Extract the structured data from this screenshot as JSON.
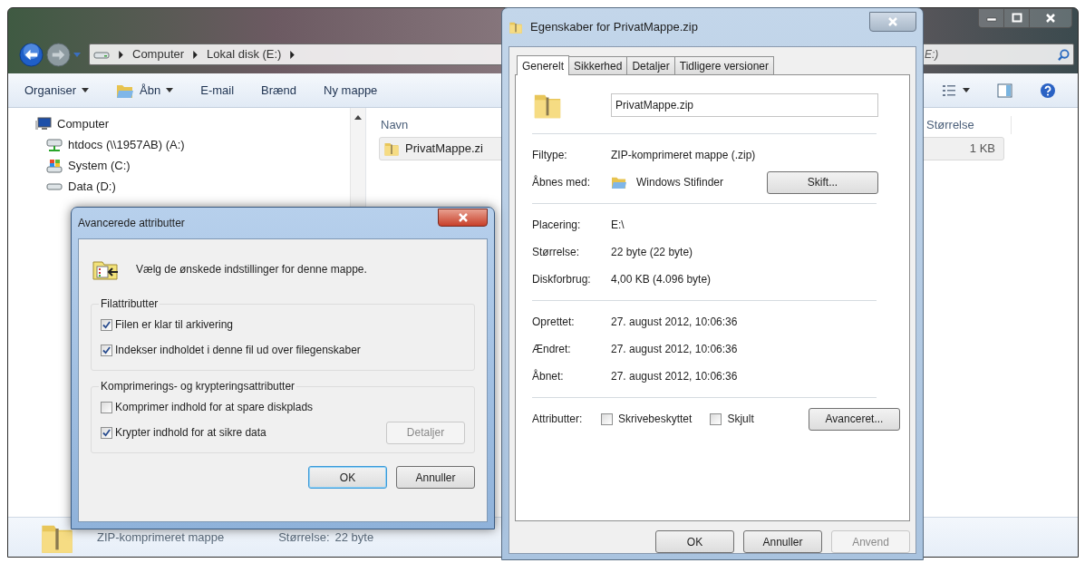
{
  "explorer": {
    "address": {
      "segments": [
        "Computer",
        "Lokal disk (E:)"
      ]
    },
    "search": {
      "placeholder": "E:)"
    },
    "toolbar": [
      {
        "label": "Organiser",
        "kind": "menu"
      },
      {
        "label": "Åbn",
        "kind": "open"
      },
      {
        "label": "E-mail",
        "kind": "plain"
      },
      {
        "label": "Brænd",
        "kind": "plain"
      },
      {
        "label": "Ny mappe",
        "kind": "plain"
      }
    ],
    "nav": [
      {
        "label": "Computer",
        "kind": "computer",
        "children": [
          {
            "label": "htdocs (\\\\1957AB) (A:)",
            "kind": "network"
          },
          {
            "label": "System (C:)",
            "kind": "system"
          },
          {
            "label": "Data (D:)",
            "kind": "drive"
          }
        ]
      }
    ],
    "columns": [
      "Navn",
      "Størrelse"
    ],
    "files": [
      {
        "name": "PrivatMappe.zi",
        "size": "1 KB",
        "selected": true
      }
    ],
    "details": {
      "type": "ZIP-komprimeret mappe",
      "size_label": "Størrelse:",
      "size": "22 byte"
    }
  },
  "properties": {
    "title": "Egenskaber for PrivatMappe.zip",
    "tabs": [
      {
        "label": "Generelt",
        "selected": true
      },
      {
        "label": "Sikkerhed",
        "selected": false
      },
      {
        "label": "Detaljer",
        "selected": false
      },
      {
        "label": "Tidligere versioner",
        "selected": false
      }
    ],
    "name": "PrivatMappe.zip",
    "sections": [
      [
        {
          "kind": "text",
          "label": "Filtype:",
          "value": "ZIP-komprimeret mappe (.zip)"
        },
        {
          "kind": "app",
          "label": "Åbnes med:",
          "value": "Windows Stifinder",
          "button": "Skift..."
        }
      ],
      [
        {
          "kind": "text",
          "label": "Placering:",
          "value": "E:\\"
        },
        {
          "kind": "text",
          "label": "Størrelse:",
          "value": "22 byte (22 byte)"
        },
        {
          "kind": "text",
          "label": "Diskforbrug:",
          "value": "4,00 KB (4.096 byte)"
        }
      ],
      [
        {
          "kind": "text",
          "label": "Oprettet:",
          "value": "27. august 2012, 10:06:36"
        },
        {
          "kind": "text",
          "label": "Ændret:",
          "value": "27. august 2012, 10:06:36"
        },
        {
          "kind": "text",
          "label": "Åbnet:",
          "value": "27. august 2012, 10:06:36"
        }
      ]
    ],
    "attributes": {
      "label": "Attributter:",
      "checkboxes": [
        {
          "label": "Skrivebeskyttet",
          "checked": false
        },
        {
          "label": "Skjult",
          "checked": false
        }
      ],
      "button": "Avanceret..."
    },
    "buttons": [
      {
        "label": "OK",
        "disabled": false
      },
      {
        "label": "Annuller",
        "disabled": false
      },
      {
        "label": "Anvend",
        "disabled": true
      }
    ]
  },
  "advanced": {
    "title": "Avancerede attributter",
    "intro": "Vælg de ønskede indstillinger for denne mappe.",
    "groups": [
      {
        "title": "Filattributter",
        "options": [
          {
            "label": "Filen er klar til arkivering",
            "checked": true
          },
          {
            "label": "Indekser indholdet i denne fil ud over filegenskaber",
            "checked": true
          }
        ]
      },
      {
        "title": "Komprimerings- og krypteringsattributter",
        "options": [
          {
            "label": "Komprimer indhold for at spare diskplads",
            "checked": false
          },
          {
            "label": "Krypter indhold for at sikre data",
            "checked": true
          }
        ],
        "button": {
          "label": "Detaljer",
          "disabled": true
        }
      }
    ],
    "buttons": [
      {
        "label": "OK",
        "default": true
      },
      {
        "label": "Annuller",
        "default": false
      }
    ]
  }
}
